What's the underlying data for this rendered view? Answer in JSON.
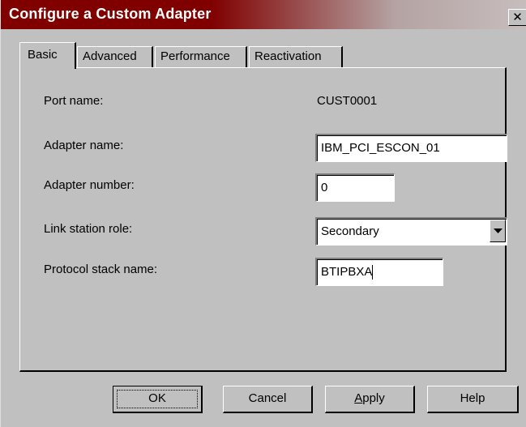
{
  "window": {
    "title": "Configure a Custom Adapter",
    "close_glyph": "✕"
  },
  "tabs": [
    {
      "label": "Basic",
      "active": true
    },
    {
      "label": "Advanced",
      "active": false
    },
    {
      "label": "Performance",
      "active": false
    },
    {
      "label": "Reactivation",
      "active": false
    }
  ],
  "form": {
    "port_name_label": "Port name:",
    "port_name_value": "CUST0001",
    "adapter_name_label": "Adapter name:",
    "adapter_name_value": "IBM_PCI_ESCON_01",
    "adapter_number_label": "Adapter number:",
    "adapter_number_value": "0",
    "link_station_role_label": "Link station role:",
    "link_station_role_value": "Secondary",
    "protocol_stack_name_label": "Protocol stack name:",
    "protocol_stack_name_value": "BTIPBXA"
  },
  "buttons": {
    "ok": "OK",
    "cancel": "Cancel",
    "apply_first": "A",
    "apply_rest": "pply",
    "help": "Help"
  },
  "icons": {
    "close": "close-icon",
    "dropdown": "chevron-down-icon"
  },
  "colors": {
    "titlebar": "#800000",
    "face": "#c0c0c0"
  }
}
